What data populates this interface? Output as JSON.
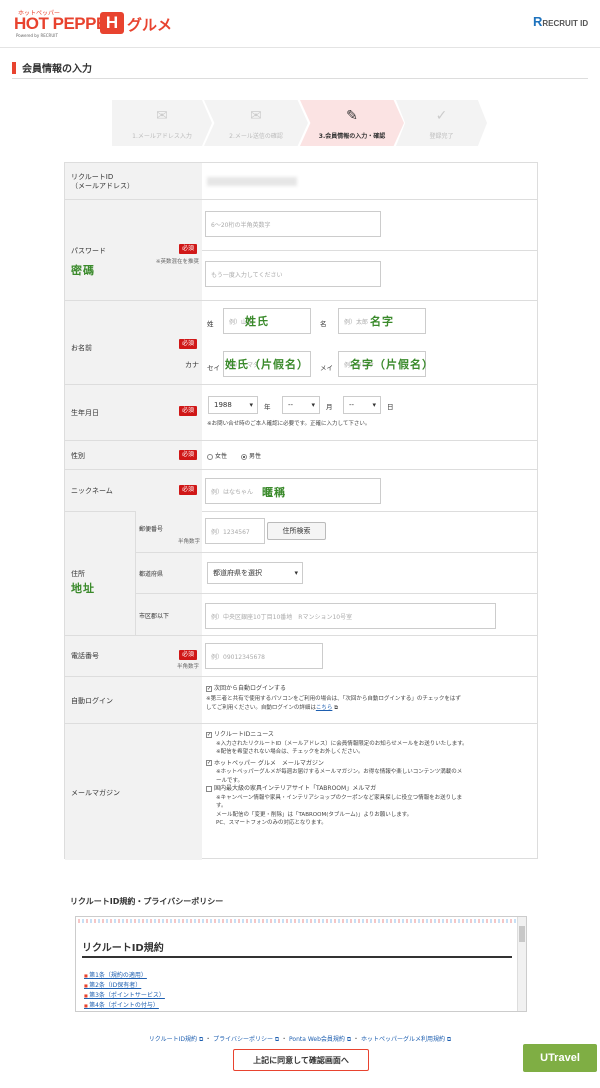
{
  "header": {
    "logo_small": "ホットペッパー",
    "logo_main": "HOT PEPPER",
    "logo_h": "H",
    "logo_gurume": "グルメ",
    "logo_powered": "Powered by RECRUIT",
    "recruit_mark": "R",
    "recruit_text": "RECRUIT ID"
  },
  "page_title": "会員情報の入力",
  "steps": [
    {
      "label": "1.メールアドレス入力",
      "icon": "envelope-icon"
    },
    {
      "label": "2.メール送信の確認",
      "icon": "envelope-check-icon"
    },
    {
      "label": "3.会員情報の入力・確認",
      "icon": "pencil-icon"
    },
    {
      "label": "登録完了",
      "icon": "check-icon"
    }
  ],
  "form": {
    "required": "必須",
    "recruit_id": {
      "label1": "リクルートID",
      "label2": "（メールアドレス）"
    },
    "password": {
      "label": "パスワード",
      "note": "※英数混在を推奨",
      "placeholder1": "6～20桁の半角英数字",
      "placeholder2": "もう一度入力してください",
      "overlay": "密碼"
    },
    "name": {
      "label": "お名前",
      "kana_label": "カナ",
      "sei": "姓",
      "mei": "名",
      "sei_kana": "セイ",
      "mei_kana": "メイ",
      "ph_sei": "例）山田",
      "ph_mei": "例）太郎",
      "ph_sei_kana": "例）ヤマダ",
      "ph_mei_kana": "例）タロウ",
      "ov_sei": "姓氏",
      "ov_mei": "名字",
      "ov_sei_kana": "姓氏（片假名）",
      "ov_mei_kana": "名字（片假名）"
    },
    "birthday": {
      "label": "生年月日",
      "year": "1988",
      "year_unit": "年",
      "month": "--",
      "month_unit": "月",
      "day": "--",
      "day_unit": "日",
      "note": "※お問い合せ時のご本人確認に必要です。正確に入力して下さい。"
    },
    "gender": {
      "label": "性別",
      "female": "女性",
      "male": "男性"
    },
    "nickname": {
      "label": "ニックネーム",
      "placeholder": "例）はなちゃん",
      "overlay": "暱稱"
    },
    "address": {
      "label": "住所",
      "overlay": "地址",
      "zip_label": "郵便番号",
      "zip_note": "半角数字",
      "zip_placeholder": "例）1234567",
      "zip_button": "住所検索",
      "pref_label": "都道府県",
      "pref_value": "都道府県を選択",
      "city_label": "市区郡以下",
      "city_placeholder": "例）中央区銀座10丁目10番地　Rマンション10号室"
    },
    "phone": {
      "label": "電話番号",
      "note": "半角数字",
      "placeholder": "例）09012345678"
    },
    "auto_login": {
      "label": "自動ログイン",
      "check": "次回から自動ログインする",
      "note1": "※第三者と共有で使用するパソコンをご利用の場合は、「次回から自動ログインする」のチェックをはず",
      "note2": "してご利用ください。自動ログインの詳細は",
      "link": "こちら"
    },
    "mail": {
      "label": "メールマガジン",
      "opt1": "リクルートIDニュース",
      "opt1_n1": "※入力されたリクルートID（メールアドレス）に会員情報限定のお知らせメールをお送りいたします。",
      "opt1_n2": "※配信を希望されない場合は、チェックをお外しください。",
      "opt2": "ホットペッパー グルメ　メールマガジン",
      "opt2_n1": "※ホットペッパーグルメが毎週お届けするメールマガジン。お得な情報や楽しいコンテンツ満載のメ",
      "opt2_n2": "ールです。",
      "opt3": "国内最大級の家具インテリアサイト「TABROOM」メルマガ",
      "opt3_n1": "※キャンペーン情報や家具・インテリアショップのクーポンなど家具探しに役立つ情報をお送りしま",
      "opt3_n2": "す。",
      "opt3_n3": "メール配信の「変更・削除」は「TABROOM(タブルーム)」よりお願いします。",
      "opt3_n4": "PC、スマートフォンのみの対応となります。"
    }
  },
  "policy": {
    "title": "リクルートID規約・プライバシーポリシー",
    "heading": "リクルートID規約",
    "items": [
      "第1条（規約の適用）",
      "第2条（ID保有者）",
      "第3条（ポイントサービス）",
      "第4条（ポイントの付与）"
    ]
  },
  "footer": {
    "link1": "リクルートID規約",
    "link2": "プライバシーポリシー",
    "link3": "Ponta Web会員規約",
    "link4": "ホットペッパーグルメ利用規約",
    "agree_button": "上記に同意して確認画面へ",
    "watermark": "UTravel"
  }
}
